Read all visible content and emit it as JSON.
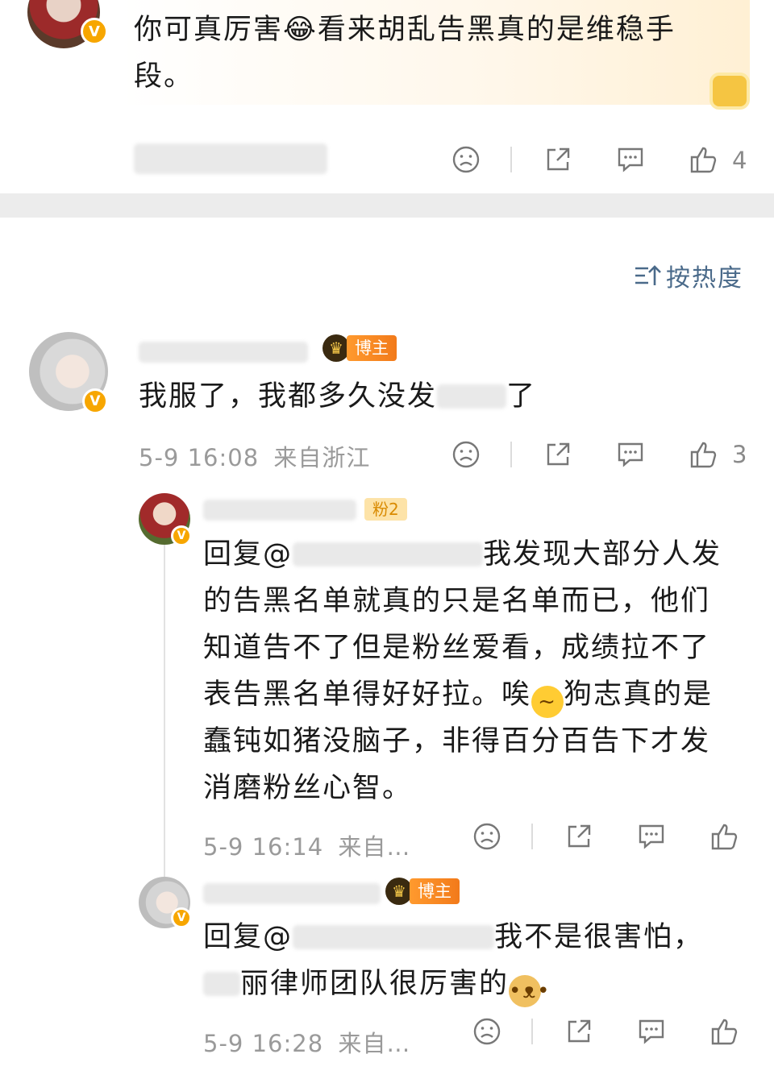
{
  "top_comment": {
    "text": "你可真厉害😂看来胡乱告黑真的是维稳手段。",
    "like_count": "4"
  },
  "sort": {
    "label": "按热度"
  },
  "comments": [
    {
      "text": "我服了，我都多久没发",
      "text_tail": "了",
      "badge": "博主",
      "time": "5-9 16:08",
      "location": "来自浙江",
      "like_count": "3"
    }
  ],
  "replies": [
    {
      "fan_badge": "粉2",
      "prefix": "回复@",
      "text": "我发现大部分人发的告黑名单就真的只是名单而已，他们知道告不了但是粉丝爱看，成绩拉不了表告黑名单得好好拉。唉",
      "text2": "狗志真的是蠢钝如猪没脑子，非得百分百告下才发消磨粉丝心智。",
      "time": "5-9 16:14",
      "location": "来自…"
    },
    {
      "badge": "博主",
      "prefix": "回复@",
      "text": "我不是很害怕，",
      "text2": "丽律师团队很厉害的",
      "time": "5-9 16:28",
      "location": "来自…"
    }
  ],
  "icons": {
    "dislike": "sad-face-icon",
    "share": "share-icon",
    "comment": "comment-icon",
    "like": "thumbs-up-icon"
  }
}
